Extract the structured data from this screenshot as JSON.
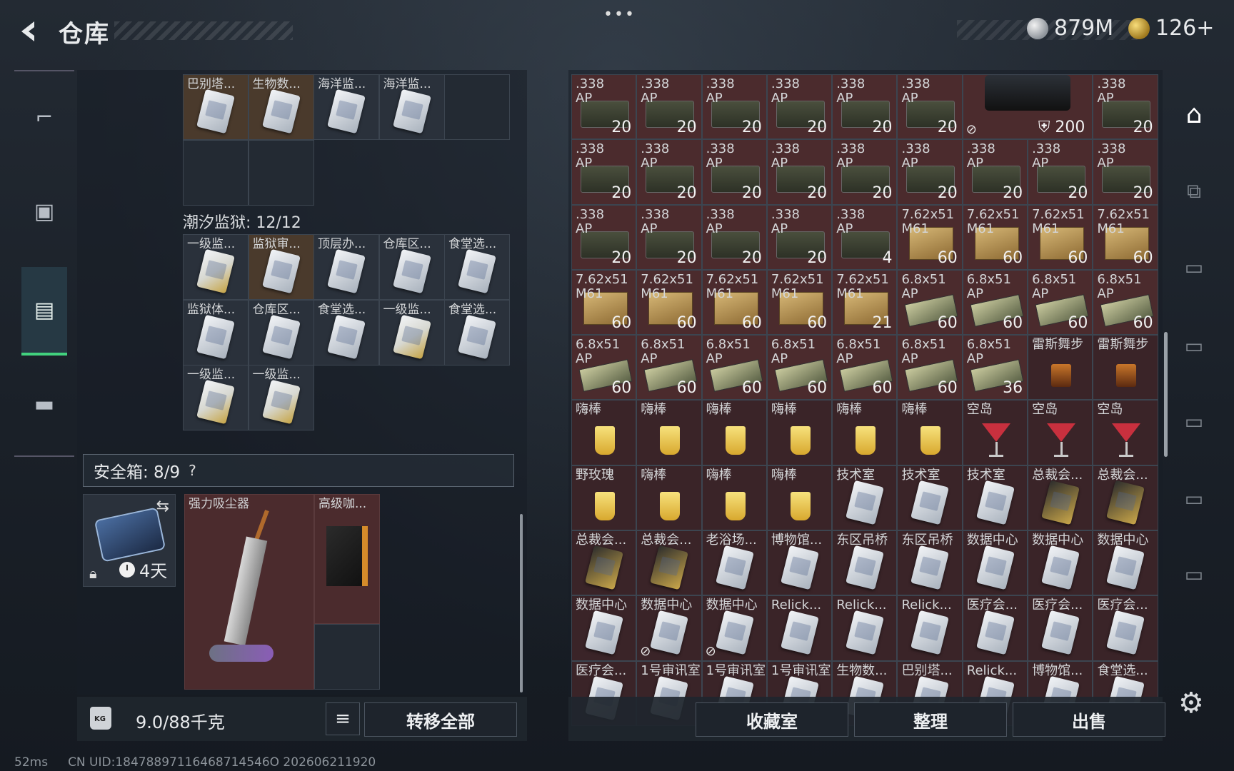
{
  "header": {
    "title": "仓库",
    "more_dots": "•••",
    "currency_silver": "879M",
    "currency_gold": "126+"
  },
  "left_rail": {
    "items": [
      {
        "name": "weapons-tab-icon",
        "glyph": "⌐"
      },
      {
        "name": "backpack-tab-icon",
        "glyph": "▣"
      },
      {
        "name": "container-tab-icon",
        "glyph": "▤"
      },
      {
        "name": "case-tab-icon",
        "glyph": "▬"
      }
    ]
  },
  "card_grid_top": {
    "cells": [
      {
        "label": "巴别塔...",
        "bg": "brown",
        "icon": "card"
      },
      {
        "label": "生物数...",
        "bg": "brown",
        "icon": "card"
      },
      {
        "label": "海洋监...",
        "bg": "normal",
        "icon": "card"
      },
      {
        "label": "海洋监...",
        "bg": "normal",
        "icon": "card"
      },
      {
        "label": "",
        "bg": "empty",
        "icon": ""
      },
      {
        "label": "",
        "bg": "empty",
        "icon": ""
      },
      {
        "label": "",
        "bg": "empty",
        "icon": ""
      }
    ]
  },
  "tide_prison": {
    "title": "潮汐监狱: 12/12",
    "cells": [
      {
        "label": "一级监...",
        "bg": "normal",
        "icon": "card gold"
      },
      {
        "label": "监狱审...",
        "bg": "brown",
        "icon": "card"
      },
      {
        "label": "顶层办...",
        "bg": "normal",
        "icon": "card"
      },
      {
        "label": "仓库区...",
        "bg": "normal",
        "icon": "card"
      },
      {
        "label": "食堂选...",
        "bg": "normal",
        "icon": "card"
      },
      {
        "label": "监狱体...",
        "bg": "normal",
        "icon": "card"
      },
      {
        "label": "仓库区...",
        "bg": "normal",
        "icon": "card"
      },
      {
        "label": "食堂选...",
        "bg": "normal",
        "icon": "card"
      },
      {
        "label": "一级监...",
        "bg": "normal",
        "icon": "card gold"
      },
      {
        "label": "食堂选...",
        "bg": "normal",
        "icon": "card"
      },
      {
        "label": "一级监...",
        "bg": "normal",
        "icon": "card gold"
      },
      {
        "label": "一级监...",
        "bg": "normal",
        "icon": "card gold"
      }
    ]
  },
  "safe_box": {
    "title": "安全箱: 8/9",
    "help": "?",
    "case_days": "4天",
    "vacuum_label": "强力吸尘器",
    "coffee_label": "高级咖..."
  },
  "footer_left": {
    "weight": "9.0/88千克",
    "list_icon": "≡",
    "transfer_all": "转移全部"
  },
  "stash_grid": {
    "cells": [
      {
        "label": ".338\nAP",
        "qty": "20",
        "icon": "ammo"
      },
      {
        "label": ".338\nAP",
        "qty": "20",
        "icon": "ammo"
      },
      {
        "label": ".338\nAP",
        "qty": "20",
        "icon": "ammo"
      },
      {
        "label": ".338\nAP",
        "qty": "20",
        "icon": "ammo"
      },
      {
        "label": ".338\nAP",
        "qty": "20",
        "icon": "ammo"
      },
      {
        "label": ".338\nAP",
        "qty": "20",
        "icon": "ammo"
      },
      {
        "label": "",
        "qty": "",
        "icon": "device",
        "span": 2,
        "extra": "200"
      },
      {
        "label": ".338\nAP",
        "qty": "20",
        "icon": "ammo"
      },
      {
        "label": ".338\nAP",
        "qty": "20",
        "icon": "ammo"
      },
      {
        "label": ".338\nAP",
        "qty": "20",
        "icon": "ammo"
      },
      {
        "label": ".338\nAP",
        "qty": "20",
        "icon": "ammo"
      },
      {
        "label": ".338\nAP",
        "qty": "20",
        "icon": "ammo"
      },
      {
        "label": ".338\nAP",
        "qty": "20",
        "icon": "ammo"
      },
      {
        "label": ".338\nAP",
        "qty": "20",
        "icon": "ammo"
      },
      {
        "label": ".338\nAP",
        "qty": "20",
        "icon": "ammo"
      },
      {
        "label": ".338\nAP",
        "qty": "20",
        "icon": "ammo"
      },
      {
        "label": ".338\nAP",
        "qty": "20",
        "icon": "ammo"
      },
      {
        "label": ".338\nAP",
        "qty": "20",
        "icon": "ammo"
      },
      {
        "label": ".338\nAP",
        "qty": "20",
        "icon": "ammo"
      },
      {
        "label": ".338\nAP",
        "qty": "20",
        "icon": "ammo"
      },
      {
        "label": ".338\nAP",
        "qty": "20",
        "icon": "ammo"
      },
      {
        "label": ".338\nAP",
        "qty": "4",
        "icon": "ammo"
      },
      {
        "label": "7.62x51\nM61",
        "qty": "60",
        "icon": "box762"
      },
      {
        "label": "7.62x51\nM61",
        "qty": "60",
        "icon": "box762"
      },
      {
        "label": "7.62x51\nM61",
        "qty": "60",
        "icon": "box762"
      },
      {
        "label": "7.62x51\nM61",
        "qty": "60",
        "icon": "box762"
      },
      {
        "label": "7.62x51\nM61",
        "qty": "60",
        "icon": "box762"
      },
      {
        "label": "7.62x51\nM61",
        "qty": "60",
        "icon": "box762"
      },
      {
        "label": "7.62x51\nM61",
        "qty": "60",
        "icon": "box762"
      },
      {
        "label": "7.62x51\nM61",
        "qty": "60",
        "icon": "box762"
      },
      {
        "label": "7.62x51\nM61",
        "qty": "21",
        "icon": "box762"
      },
      {
        "label": "6.8x51\nAP",
        "qty": "60",
        "icon": "box68"
      },
      {
        "label": "6.8x51\nAP",
        "qty": "60",
        "icon": "box68"
      },
      {
        "label": "6.8x51\nAP",
        "qty": "60",
        "icon": "box68"
      },
      {
        "label": "6.8x51\nAP",
        "qty": "60",
        "icon": "box68"
      },
      {
        "label": "6.8x51\nAP",
        "qty": "60",
        "icon": "box68"
      },
      {
        "label": "6.8x51\nAP",
        "qty": "60",
        "icon": "box68"
      },
      {
        "label": "6.8x51\nAP",
        "qty": "60",
        "icon": "box68"
      },
      {
        "label": "6.8x51\nAP",
        "qty": "60",
        "icon": "box68"
      },
      {
        "label": "6.8x51\nAP",
        "qty": "60",
        "icon": "box68"
      },
      {
        "label": "6.8x51\nAP",
        "qty": "60",
        "icon": "box68"
      },
      {
        "label": "6.8x51\nAP",
        "qty": "36",
        "icon": "box68"
      },
      {
        "label": "雷斯舞步",
        "qty": "",
        "icon": "darkdrink"
      },
      {
        "label": "雷斯舞步",
        "qty": "",
        "icon": "darkdrink"
      },
      {
        "label": "嗨棒",
        "qty": "",
        "icon": "drink"
      },
      {
        "label": "嗨棒",
        "qty": "",
        "icon": "drink"
      },
      {
        "label": "嗨棒",
        "qty": "",
        "icon": "drink"
      },
      {
        "label": "嗨棒",
        "qty": "",
        "icon": "drink"
      },
      {
        "label": "嗨棒",
        "qty": "",
        "icon": "drink"
      },
      {
        "label": "嗨棒",
        "qty": "",
        "icon": "drink"
      },
      {
        "label": "空岛",
        "qty": "",
        "icon": "cocktail"
      },
      {
        "label": "空岛",
        "qty": "",
        "icon": "cocktail"
      },
      {
        "label": "空岛",
        "qty": "",
        "icon": "cocktail"
      },
      {
        "label": "野玫瑰",
        "qty": "",
        "icon": "drink"
      },
      {
        "label": "嗨棒",
        "qty": "",
        "icon": "drink"
      },
      {
        "label": "嗨棒",
        "qty": "",
        "icon": "drink"
      },
      {
        "label": "嗨棒",
        "qty": "",
        "icon": "drink"
      },
      {
        "label": "技术室",
        "qty": "",
        "icon": "card"
      },
      {
        "label": "技术室",
        "qty": "",
        "icon": "card"
      },
      {
        "label": "技术室",
        "qty": "",
        "icon": "card"
      },
      {
        "label": "总裁会...",
        "qty": "",
        "icon": "card black"
      },
      {
        "label": "总裁会...",
        "qty": "",
        "icon": "card black"
      },
      {
        "label": "总裁会...",
        "qty": "",
        "icon": "card black"
      },
      {
        "label": "总裁会...",
        "qty": "",
        "icon": "card black"
      },
      {
        "label": "老浴场...",
        "qty": "",
        "icon": "card"
      },
      {
        "label": "博物馆...",
        "qty": "",
        "icon": "card"
      },
      {
        "label": "东区吊桥",
        "qty": "",
        "icon": "card"
      },
      {
        "label": "东区吊桥",
        "qty": "",
        "icon": "card"
      },
      {
        "label": "数据中心",
        "qty": "",
        "icon": "card"
      },
      {
        "label": "数据中心",
        "qty": "",
        "icon": "card"
      },
      {
        "label": "数据中心",
        "qty": "",
        "icon": "card"
      },
      {
        "label": "数据中心",
        "qty": "",
        "icon": "card"
      },
      {
        "label": "数据中心",
        "qty": "",
        "icon": "card",
        "flag": "⊘"
      },
      {
        "label": "数据中心",
        "qty": "",
        "icon": "card",
        "flag": "⊘"
      },
      {
        "label": "Relick...",
        "qty": "",
        "icon": "card"
      },
      {
        "label": "Relick...",
        "qty": "",
        "icon": "card"
      },
      {
        "label": "Relick...",
        "qty": "",
        "icon": "card"
      },
      {
        "label": "医疗会...",
        "qty": "",
        "icon": "card"
      },
      {
        "label": "医疗会...",
        "qty": "",
        "icon": "card"
      },
      {
        "label": "医疗会...",
        "qty": "",
        "icon": "card"
      },
      {
        "label": "医疗会...",
        "qty": "",
        "icon": "card"
      },
      {
        "label": "1号审讯室",
        "qty": "",
        "icon": "card"
      },
      {
        "label": "1号审讯室",
        "qty": "",
        "icon": "card"
      },
      {
        "label": "1号审讯室",
        "qty": "",
        "icon": "card"
      },
      {
        "label": "生物数...",
        "qty": "",
        "icon": "card"
      },
      {
        "label": "巴别塔...",
        "qty": "",
        "icon": "card"
      },
      {
        "label": "Relick...",
        "qty": "",
        "icon": "card"
      },
      {
        "label": "博物馆...",
        "qty": "",
        "icon": "card"
      },
      {
        "label": "食堂选...",
        "qty": "",
        "icon": "card"
      }
    ]
  },
  "footer_right": {
    "collection_room": "收藏室",
    "organize": "整理",
    "sell": "出售"
  },
  "right_rail": {
    "items": [
      {
        "name": "home-stash-icon",
        "glyph": "⌂"
      },
      {
        "name": "grid-filter-icon",
        "glyph": "⧉"
      },
      {
        "name": "ticket-filter-icon",
        "glyph": "▭"
      },
      {
        "name": "ticket-filter-icon",
        "glyph": "▭"
      },
      {
        "name": "ticket-filter-icon",
        "glyph": "▭"
      },
      {
        "name": "ticket-filter-icon",
        "glyph": "▭"
      },
      {
        "name": "ticket-filter-icon",
        "glyph": "▭"
      }
    ]
  },
  "status_bar": {
    "ping": "52ms",
    "uid": "CN UID:18478897116468714546O 202606211920"
  }
}
